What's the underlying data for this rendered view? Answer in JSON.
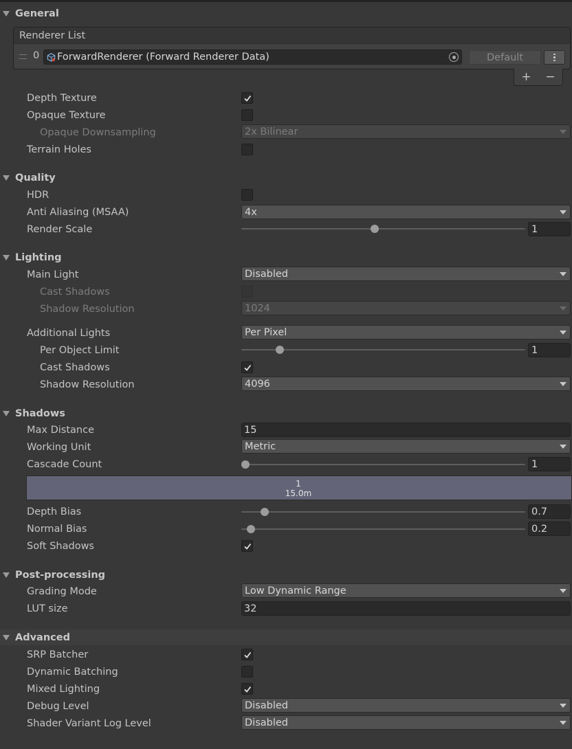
{
  "sections": {
    "general": "General",
    "quality": "Quality",
    "lighting": "Lighting",
    "shadows": "Shadows",
    "post_processing": "Post-processing",
    "advanced": "Advanced"
  },
  "renderer_list": {
    "header": "Renderer List",
    "index": "0",
    "renderer_name": "ForwardRenderer (Forward Renderer Data)",
    "default_label": "Default",
    "add_label": "+",
    "remove_label": "−"
  },
  "general": {
    "depth_texture": {
      "label": "Depth Texture",
      "checked": true
    },
    "opaque_texture": {
      "label": "Opaque Texture",
      "checked": false
    },
    "opaque_downsampling": {
      "label": "Opaque Downsampling",
      "value": "2x Bilinear"
    },
    "terrain_holes": {
      "label": "Terrain Holes",
      "checked": false
    }
  },
  "quality": {
    "hdr": {
      "label": "HDR",
      "checked": false
    },
    "msaa": {
      "label": "Anti Aliasing (MSAA)",
      "value": "4x"
    },
    "render_scale": {
      "label": "Render Scale",
      "value": "1",
      "slider_fraction": 0.47
    }
  },
  "lighting": {
    "main_light": {
      "label": "Main Light",
      "value": "Disabled"
    },
    "main_cast_shadows": {
      "label": "Cast Shadows",
      "checked": false
    },
    "main_shadow_resolution": {
      "label": "Shadow Resolution",
      "value": "1024"
    },
    "additional_lights": {
      "label": "Additional Lights",
      "value": "Per Pixel"
    },
    "per_object_limit": {
      "label": "Per Object Limit",
      "value": "1",
      "slider_fraction": 0.125
    },
    "additional_cast_shadows": {
      "label": "Cast Shadows",
      "checked": true
    },
    "additional_shadow_resolution": {
      "label": "Shadow Resolution",
      "value": "4096"
    }
  },
  "shadows": {
    "max_distance": {
      "label": "Max Distance",
      "value": "15"
    },
    "working_unit": {
      "label": "Working Unit",
      "value": "Metric"
    },
    "cascade_count": {
      "label": "Cascade Count",
      "value": "1",
      "slider_fraction": 0.0
    },
    "cascade_index": "1",
    "cascade_distance": "15.0m",
    "depth_bias": {
      "label": "Depth Bias",
      "value": "0.7",
      "slider_fraction": 0.07
    },
    "normal_bias": {
      "label": "Normal Bias",
      "value": "0.2",
      "slider_fraction": 0.02
    },
    "soft_shadows": {
      "label": "Soft Shadows",
      "checked": true
    }
  },
  "post_processing": {
    "grading_mode": {
      "label": "Grading Mode",
      "value": "Low Dynamic Range"
    },
    "lut_size": {
      "label": "LUT size",
      "value": "32"
    }
  },
  "advanced": {
    "srp_batcher": {
      "label": "SRP Batcher",
      "checked": true
    },
    "dynamic_batching": {
      "label": "Dynamic Batching",
      "checked": false
    },
    "mixed_lighting": {
      "label": "Mixed Lighting",
      "checked": true
    },
    "debug_level": {
      "label": "Debug Level",
      "value": "Disabled"
    },
    "shader_variant_log_level": {
      "label": "Shader Variant Log Level",
      "value": "Disabled"
    }
  }
}
